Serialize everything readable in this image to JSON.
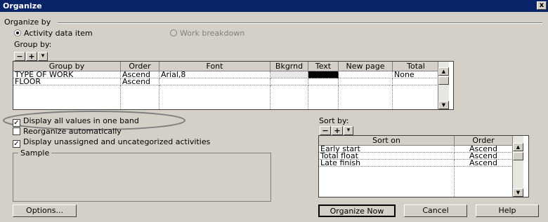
{
  "window": {
    "title": "Organize",
    "close_glyph": "x"
  },
  "organize_by": {
    "label": "Organize by",
    "option1": "Activity data item",
    "option2": "Work breakdown",
    "selected": "Activity data item"
  },
  "group_by": {
    "label": "Group by:",
    "toolbar": {
      "remove": "−",
      "add": "+",
      "dropdown": "▾"
    },
    "columns": [
      "Group by",
      "Order",
      "Font",
      "Bkgrnd",
      "Text",
      "New page",
      "Total"
    ],
    "rows": [
      {
        "group_by": "TYPE OF WORK",
        "order": "Ascend",
        "font": "Arial,8",
        "bkgrnd": "",
        "text": "",
        "new_page": "",
        "total": "None"
      },
      {
        "group_by": "FLOOR",
        "order": "Ascend",
        "font": "",
        "bkgrnd": "",
        "text": "",
        "new_page": "",
        "total": ""
      }
    ],
    "text_color_swatch": "#000000"
  },
  "options": {
    "display_all_values": "Display all values in one band",
    "reorganize_auto": "Reorganize automatically",
    "display_unassigned": "Display unassigned and uncategorized activities",
    "display_all_checked": true,
    "reorganize_checked": false,
    "display_unassigned_checked": true
  },
  "sample": {
    "label": "Sample"
  },
  "sort_by": {
    "label": "Sort by:",
    "toolbar": {
      "remove": "−",
      "add": "+",
      "dropdown": "▾"
    },
    "columns": [
      "Sort on",
      "Order"
    ],
    "rows": [
      {
        "sort_on": "Early start",
        "order": "Ascend"
      },
      {
        "sort_on": "Total float",
        "order": "Ascend"
      },
      {
        "sort_on": "Late finish",
        "order": "Ascend"
      }
    ]
  },
  "buttons": {
    "options": "Options...",
    "organize_now": "Organize Now",
    "cancel": "Cancel",
    "help": "Help"
  },
  "colors": {
    "titlebar": "#0a246a",
    "dialog": "#d4d0c8",
    "highlight_ellipse": "#808080"
  }
}
